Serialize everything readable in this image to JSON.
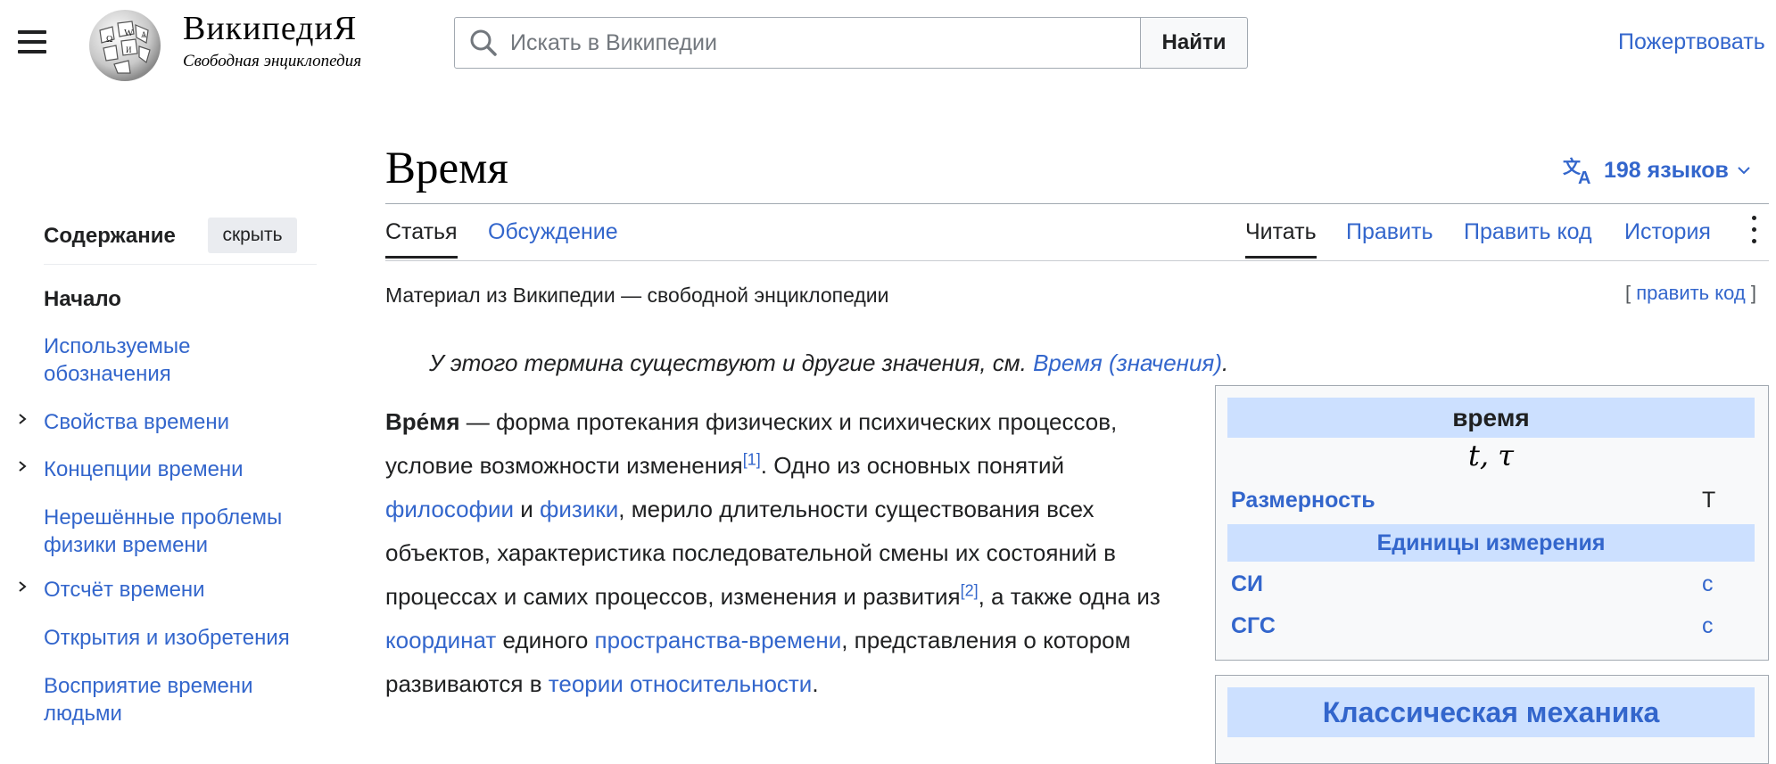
{
  "header": {
    "wordmark": "ВикипедиЯ",
    "tagline": "Свободная энциклопедия",
    "search_placeholder": "Искать в Википедии",
    "search_button": "Найти",
    "donate": "Пожертвовать"
  },
  "page": {
    "title": "Время",
    "languages": "198 языков",
    "tabs": {
      "article": "Статья",
      "talk": "Обсуждение",
      "read": "Читать",
      "edit": "Править",
      "edit_code": "Править код",
      "history": "История"
    },
    "from_wiki": "Материал из Википедии — свободной энциклопедии",
    "edit_section": {
      "open": "[",
      "label": "править код",
      "close": "]"
    },
    "hatnote": {
      "text": "У этого термина существуют и другие значения, см. ",
      "link": "Время (значения)",
      "end": "."
    }
  },
  "toc": {
    "title": "Содержание",
    "hide": "скрыть",
    "items": [
      {
        "label": "Начало",
        "top": true
      },
      {
        "label": "Используемые обозначения"
      },
      {
        "label": "Свойства времени",
        "expandable": true
      },
      {
        "label": "Концепции времени",
        "expandable": true
      },
      {
        "label": "Нерешённые проблемы физики времени"
      },
      {
        "label": "Отсчёт времени",
        "expandable": true
      },
      {
        "label": "Открытия и изобретения"
      },
      {
        "label": "Восприятие времени людьми"
      }
    ]
  },
  "article": {
    "term": "Вре́мя",
    "t1": " — форма протекания физических и психических процессов, условие возможности изменения",
    "ref1": "[1]",
    "t2": ". Одно из основных понятий ",
    "link_philosophy": "философии",
    "t3": " и ",
    "link_physics": "физики",
    "t4": ", мерило длительности существования всех объектов, характеристика последовательной смены их состояний в процессах и самих процессов, изменения и развития",
    "ref2": "[2]",
    "t5": ", а также одна из ",
    "link_coords": "координат",
    "t6": " единого ",
    "link_spacetime": "пространства-времени",
    "t7": ", представления о котором развиваются в ",
    "link_relativity": "теории относительности",
    "t8": "."
  },
  "infobox": {
    "header": "время",
    "symbol": "t, τ",
    "dimension_label": "Размерность",
    "dimension_value": "T",
    "units_header": "Единицы измерения",
    "si_label": "СИ",
    "si_value": "с",
    "cgs_label": "СГС",
    "cgs_value": "с"
  },
  "infobox2": {
    "header": "Классическая механика"
  }
}
